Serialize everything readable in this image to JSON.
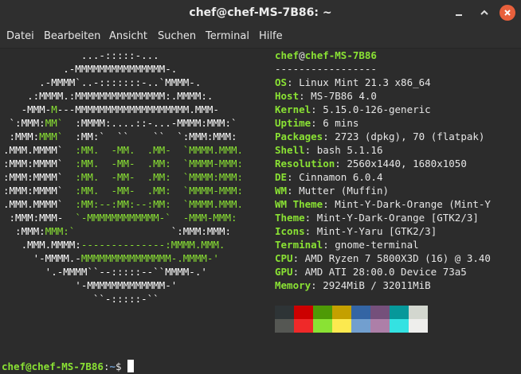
{
  "window": {
    "title": "chef@chef-MS-7B86: ~"
  },
  "menu": [
    "Datei",
    "Bearbeiten",
    "Ansicht",
    "Suchen",
    "Terminal",
    "Hilfe"
  ],
  "logo_lines": [
    [
      [
        "w",
        "             ...-:::::-..."
      ]
    ],
    [
      [
        "w",
        "          .-MMMMMMMMMMMMMMM-."
      ]
    ],
    [
      [
        "w",
        "      .-MMMM`..-:::::::-..`MMMM-."
      ]
    ],
    [
      [
        "w",
        "    .:MMMM.:MMMMMMMMMMMMMMM:.MMMM:."
      ]
    ],
    [
      [
        "w",
        "   -MMM-"
      ],
      [
        "g",
        "M"
      ],
      [
        "w",
        "---MMMMMMMMMMMMMMMMMMM.MMM-"
      ]
    ],
    [
      [
        "w",
        " `:MMM:"
      ],
      [
        "g",
        "MM`"
      ],
      [
        "w",
        "  :MMMM:....::-...-MMMM:MMM:`"
      ]
    ],
    [
      [
        "w",
        " :MMM:"
      ],
      [
        "g",
        "MMM`"
      ],
      [
        "w",
        "  :MM:`  ``    ``  `:MMM:MMM:"
      ]
    ],
    [
      [
        "w",
        ".MMM.MMMM`"
      ],
      [
        "g",
        "  :MM.  -MM.  .MM-  `MMMM.MMM."
      ]
    ],
    [
      [
        "w",
        ":MMM:MMMM`"
      ],
      [
        "g",
        "  :MM.  -MM-  .MM:  `MMMM-MMM:"
      ]
    ],
    [
      [
        "w",
        ":MMM:MMMM`"
      ],
      [
        "g",
        "  :MM.  -MM-  .MM:  `MMMM:MMM:"
      ]
    ],
    [
      [
        "w",
        ":MMM:MMMM`"
      ],
      [
        "g",
        "  :MM.  -MM-  .MM:  `MMMM-MMM:"
      ]
    ],
    [
      [
        "w",
        ".MMM.MMMM`"
      ],
      [
        "g",
        "  :MM:--:MM:--:MM:  `MMMM.MMM."
      ]
    ],
    [
      [
        "w",
        " :MMM:MMM-"
      ],
      [
        "g",
        "  `-MMMMMMMMMMMM-`  -MMM-MMM:"
      ]
    ],
    [
      [
        "w",
        "  :MMM:"
      ],
      [
        "g",
        "MMM:`"
      ],
      [
        "w",
        "                `:MMM:MMM:"
      ]
    ],
    [
      [
        "w",
        "   .MMM.MMMM:"
      ],
      [
        "g",
        "--------------:MMMM.MMM."
      ]
    ],
    [
      [
        "w",
        "     '-MMMM.-"
      ],
      [
        "g",
        "MMMMMMMMMMMMMMM-.MMMM-'"
      ]
    ],
    [
      [
        "w",
        "       '.-MMMM``--:::::--``MMMM-.'"
      ]
    ],
    [
      [
        "w",
        "            '-MMMMMMMMMMMMM-'"
      ]
    ],
    [
      [
        "w",
        "               ``-:::::-``"
      ]
    ]
  ],
  "info": {
    "user": "chef",
    "at": "@",
    "host": "chef-MS-7B86",
    "separator": "-----------------",
    "fields": [
      {
        "key": "OS",
        "value": "Linux Mint 21.3 x86_64"
      },
      {
        "key": "Host",
        "value": "MS-7B86 4.0"
      },
      {
        "key": "Kernel",
        "value": "5.15.0-126-generic"
      },
      {
        "key": "Uptime",
        "value": "6 mins"
      },
      {
        "key": "Packages",
        "value": "2723 (dpkg), 70 (flatpak)"
      },
      {
        "key": "Shell",
        "value": "bash 5.1.16"
      },
      {
        "key": "Resolution",
        "value": "2560x1440, 1680x1050"
      },
      {
        "key": "DE",
        "value": "Cinnamon 6.0.4"
      },
      {
        "key": "WM",
        "value": "Mutter (Muffin)"
      },
      {
        "key": "WM Theme",
        "value": "Mint-Y-Dark-Orange (Mint-Y"
      },
      {
        "key": "Theme",
        "value": "Mint-Y-Dark-Orange [GTK2/3]"
      },
      {
        "key": "Icons",
        "value": "Mint-Y-Yaru [GTK2/3]"
      },
      {
        "key": "Terminal",
        "value": "gnome-terminal"
      },
      {
        "key": "CPU",
        "value": "AMD Ryzen 7 5800X3D (16) @ 3.40"
      },
      {
        "key": "GPU",
        "value": "AMD ATI 28:00.0 Device 73a5"
      },
      {
        "key": "Memory",
        "value": "2924MiB / 32011MiB"
      }
    ],
    "colon": ": "
  },
  "palette_row1": [
    "#2e3436",
    "#cc0000",
    "#4e9a06",
    "#c4a000",
    "#3465a4",
    "#75507b",
    "#06989a",
    "#d3d7cf"
  ],
  "palette_row2": [
    "#555753",
    "#ef2929",
    "#8ae234",
    "#fce94f",
    "#729fcf",
    "#ad7fa8",
    "#34e2e2",
    "#eeeeec"
  ],
  "prompt": {
    "user_host": "chef@chef-MS-7B86",
    "colon": ":",
    "path": "~",
    "symbol": "$ "
  }
}
